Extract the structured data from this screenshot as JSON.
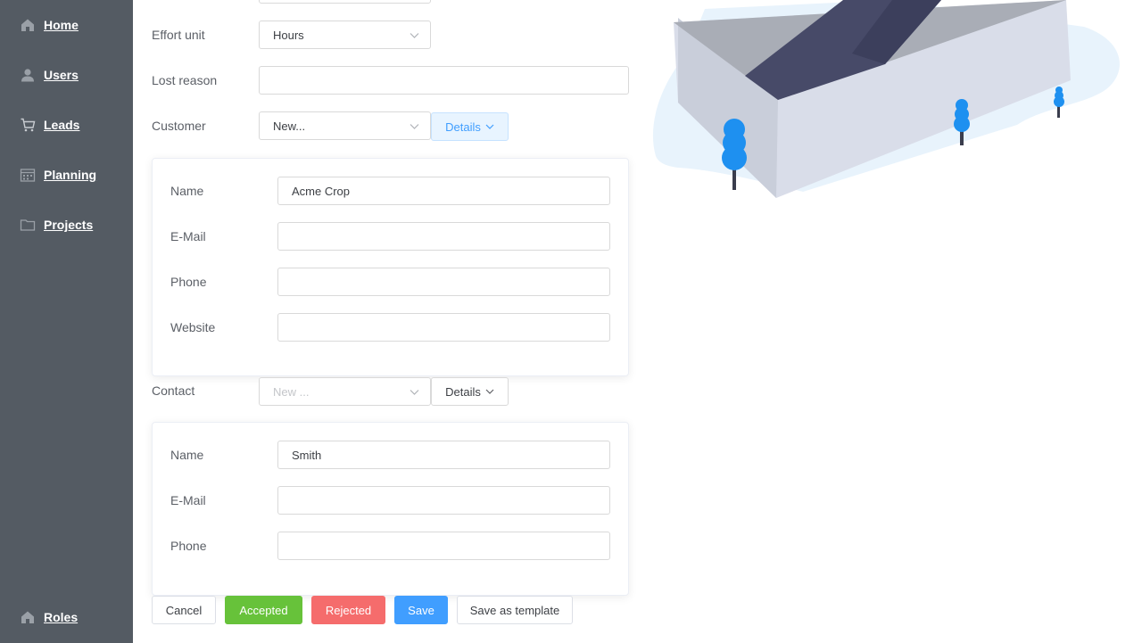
{
  "sidebar": {
    "items": [
      {
        "label": "Home",
        "icon": "home-icon"
      },
      {
        "label": "Users",
        "icon": "user-icon"
      },
      {
        "label": "Leads",
        "icon": "cart-icon"
      },
      {
        "label": "Planning",
        "icon": "calendar-icon"
      },
      {
        "label": "Projects",
        "icon": "folder-icon"
      }
    ],
    "footer_item": {
      "label": "Roles",
      "icon": "home-icon"
    }
  },
  "form": {
    "effort_unit": {
      "label": "Effort unit",
      "value": "Hours"
    },
    "lost_reason": {
      "label": "Lost reason",
      "value": ""
    },
    "customer": {
      "label": "Customer",
      "select_value": "New...",
      "details_label": "Details",
      "fields": {
        "name": {
          "label": "Name",
          "value": "Acme Crop"
        },
        "email": {
          "label": "E-Mail",
          "value": ""
        },
        "phone": {
          "label": "Phone",
          "value": ""
        },
        "website": {
          "label": "Website",
          "value": ""
        }
      }
    },
    "contact": {
      "label": "Contact",
      "select_placeholder": "New ...",
      "details_label": "Details",
      "fields": {
        "name": {
          "label": "Name",
          "value": "Smith"
        },
        "email": {
          "label": "E-Mail",
          "value": ""
        },
        "phone": {
          "label": "Phone",
          "value": ""
        }
      }
    }
  },
  "actions": {
    "cancel": "Cancel",
    "accepted": "Accepted",
    "rejected": "Rejected",
    "save": "Save",
    "save_template": "Save as template"
  },
  "colors": {
    "sidebar": "#545b63",
    "accent_blue": "#409eff",
    "success_green": "#67c23a",
    "danger_red": "#f56c6c"
  }
}
